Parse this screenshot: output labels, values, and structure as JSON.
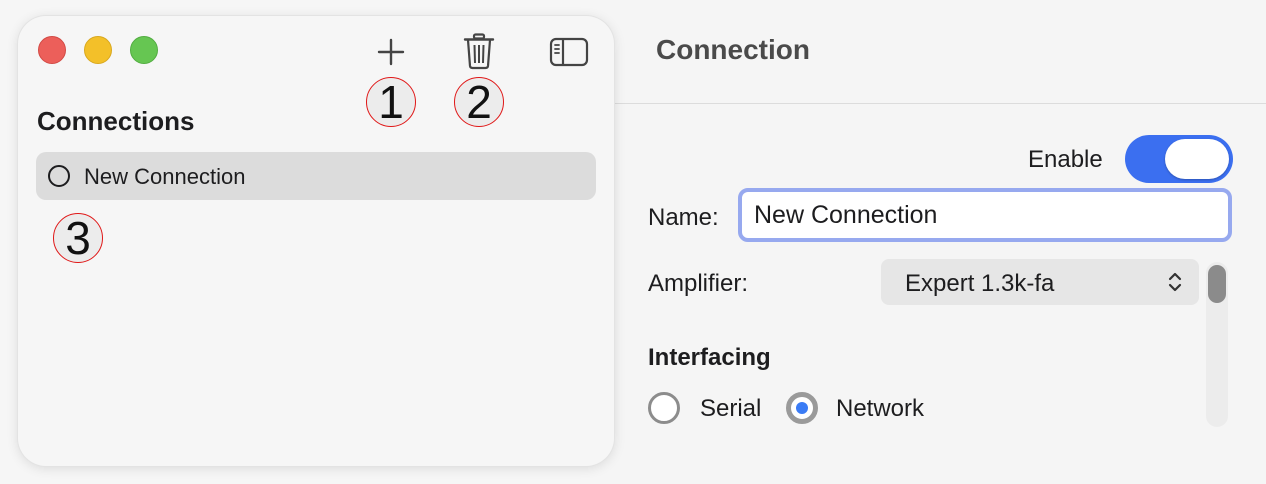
{
  "sidebar": {
    "heading": "Connections",
    "toolbar": {
      "add_icon": "plus-icon",
      "delete_icon": "trash-icon",
      "toggle_icon": "sidebar-toggle-icon"
    },
    "items": [
      {
        "label": "New Connection",
        "status": "disconnected",
        "selected": true
      }
    ]
  },
  "detail": {
    "title": "Connection",
    "enable": {
      "label": "Enable",
      "on": true
    },
    "name": {
      "label": "Name:",
      "value": "New Connection"
    },
    "amplifier": {
      "label": "Amplifier:",
      "value": "Expert 1.3k-fa"
    },
    "interfacing": {
      "title": "Interfacing",
      "options": [
        {
          "label": "Serial",
          "selected": false
        },
        {
          "label": "Network",
          "selected": true
        }
      ]
    }
  },
  "annotations": [
    "1",
    "2",
    "3"
  ],
  "colors": {
    "accent": "#3b6ff0",
    "focus_ring": "#97a9ef",
    "annotation_ring": "#e01818",
    "close": "#ec5f5a",
    "minimize": "#f3c029",
    "zoom": "#66c652"
  }
}
